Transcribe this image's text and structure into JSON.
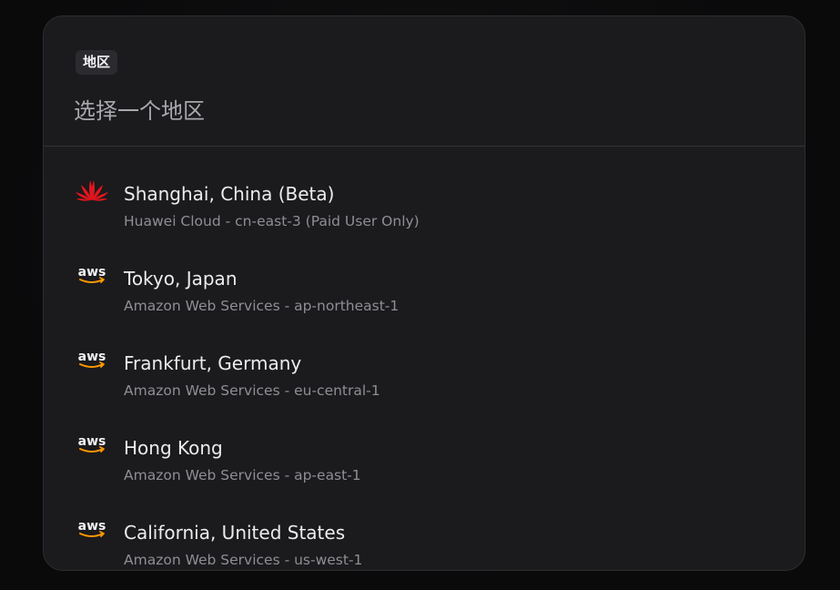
{
  "dialog": {
    "tag_label": "地区",
    "search_placeholder": "选择一个地区",
    "search_value": ""
  },
  "regions": [
    {
      "title": "Shanghai, China (Beta)",
      "subtitle": "Huawei Cloud - cn-east-3 (Paid User Only)",
      "icon": "huawei-logo-icon"
    },
    {
      "title": "Tokyo, Japan",
      "subtitle": "Amazon Web Services - ap-northeast-1",
      "icon": "aws-logo-icon"
    },
    {
      "title": "Frankfurt, Germany",
      "subtitle": "Amazon Web Services - eu-central-1",
      "icon": "aws-logo-icon"
    },
    {
      "title": "Hong Kong",
      "subtitle": "Amazon Web Services - ap-east-1",
      "icon": "aws-logo-icon"
    },
    {
      "title": "California, United States",
      "subtitle": "Amazon Web Services - us-west-1",
      "icon": "aws-logo-icon"
    }
  ],
  "colors": {
    "dialog_bg": "#1b1a1d",
    "huawei_red": "#e3151d",
    "aws_text": "#f2f2f2",
    "aws_smile": "#ff9900"
  },
  "logos": {
    "aws_wordmark": "aws"
  }
}
